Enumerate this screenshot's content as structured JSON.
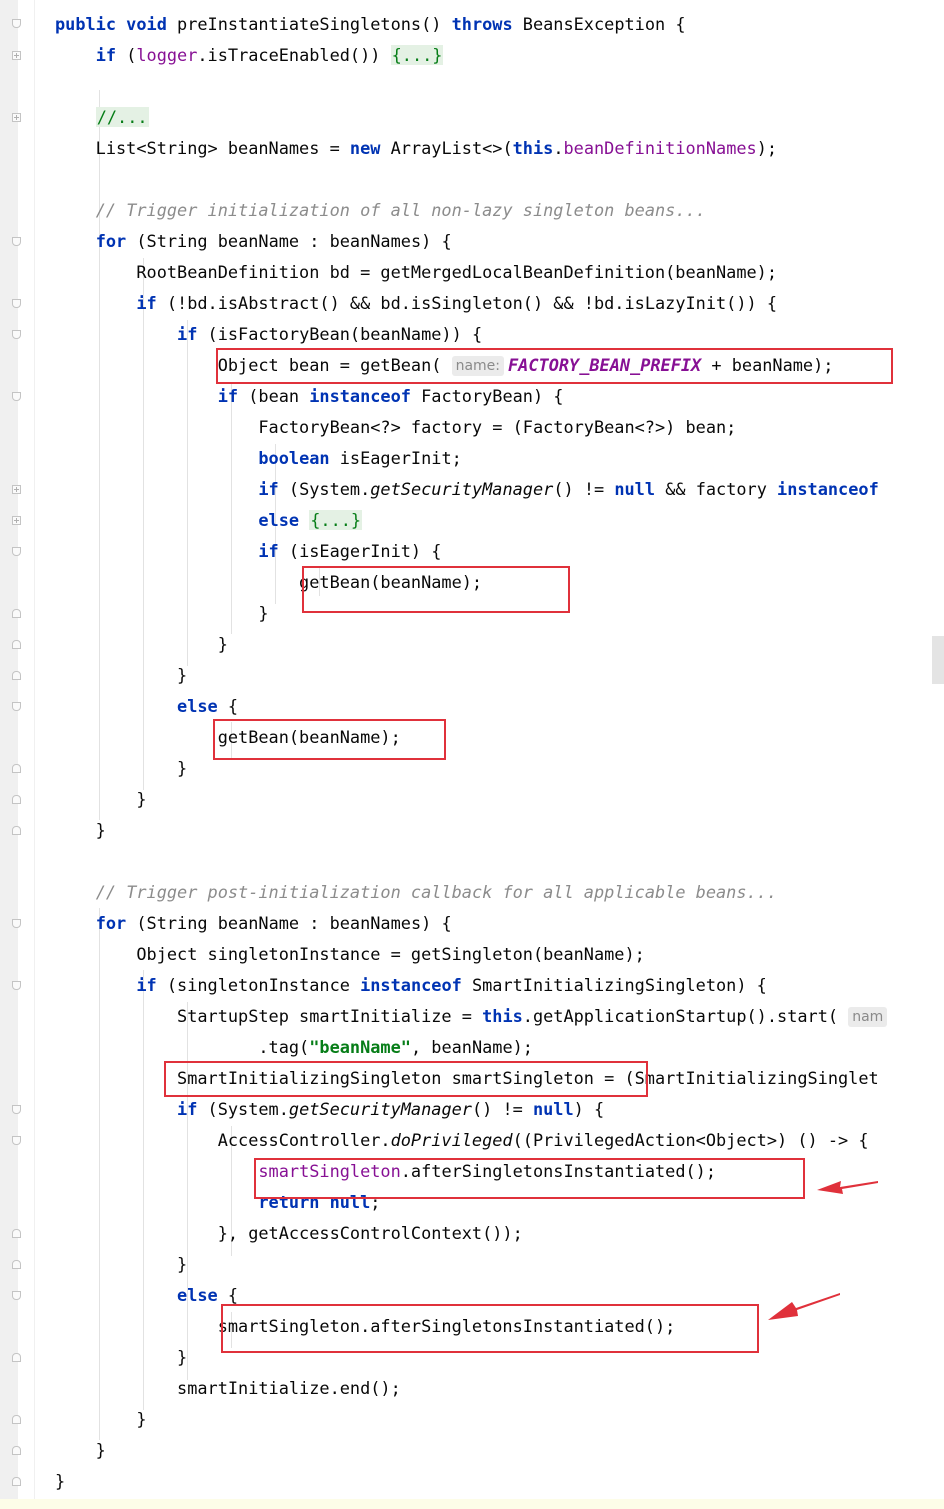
{
  "editor": {
    "lines": [
      [
        {
          "t": "public void ",
          "c": "kw"
        },
        {
          "t": "preInstantiateSingletons() "
        },
        {
          "t": "throws ",
          "c": "kw"
        },
        {
          "t": "BeansException {"
        }
      ],
      [
        {
          "t": "    "
        },
        {
          "t": "if ",
          "c": "kw"
        },
        {
          "t": "("
        },
        {
          "t": "logger",
          "c": "fld"
        },
        {
          "t": ".isTraceEnabled()) "
        },
        {
          "t": "{...}",
          "c": "fold-ph"
        }
      ],
      [],
      [
        {
          "t": "    "
        },
        {
          "t": "//...",
          "c": "fold-ph"
        }
      ],
      [
        {
          "t": "    List<String> beanNames = "
        },
        {
          "t": "new ",
          "c": "kw"
        },
        {
          "t": "ArrayList<>("
        },
        {
          "t": "this",
          "c": "kw"
        },
        {
          "t": "."
        },
        {
          "t": "beanDefinitionNames",
          "c": "fld"
        },
        {
          "t": ");"
        }
      ],
      [],
      [
        {
          "t": "    "
        },
        {
          "t": "// Trigger initialization of all non-lazy singleton beans...",
          "c": "cm"
        }
      ],
      [
        {
          "t": "    "
        },
        {
          "t": "for ",
          "c": "kw"
        },
        {
          "t": "(String beanName : beanNames) {"
        }
      ],
      [
        {
          "t": "        RootBeanDefinition bd = getMergedLocalBeanDefinition(beanName);"
        }
      ],
      [
        {
          "t": "        "
        },
        {
          "t": "if ",
          "c": "kw"
        },
        {
          "t": "(!bd.isAbstract() && bd.isSingleton() && !bd.isLazyInit()) {"
        }
      ],
      [
        {
          "t": "            "
        },
        {
          "t": "if ",
          "c": "kw"
        },
        {
          "t": "(isFactoryBean(beanName)) {"
        }
      ],
      [
        {
          "t": "                Object bean = getBean( "
        },
        {
          "t": "name:",
          "c": "hint"
        },
        {
          "t": "FACTORY_BEAN_PREFIX",
          "c": "fldi"
        },
        {
          "t": " + beanName);"
        }
      ],
      [
        {
          "t": "                "
        },
        {
          "t": "if ",
          "c": "kw"
        },
        {
          "t": "(bean "
        },
        {
          "t": "instanceof ",
          "c": "kw"
        },
        {
          "t": "FactoryBean) {"
        }
      ],
      [
        {
          "t": "                    FactoryBean<?> factory = (FactoryBean<?>) bean;"
        }
      ],
      [
        {
          "t": "                    "
        },
        {
          "t": "boolean ",
          "c": "kw"
        },
        {
          "t": "isEagerInit;"
        }
      ],
      [
        {
          "t": "                    "
        },
        {
          "t": "if ",
          "c": "kw"
        },
        {
          "t": "(System."
        },
        {
          "t": "getSecurityManager",
          "c": "it"
        },
        {
          "t": "() != "
        },
        {
          "t": "null ",
          "c": "kw"
        },
        {
          "t": "&& factory "
        },
        {
          "t": "instanceof",
          "c": "kw"
        }
      ],
      [
        {
          "t": "                    "
        },
        {
          "t": "else ",
          "c": "kw"
        },
        {
          "t": "{...}",
          "c": "fold-ph"
        }
      ],
      [
        {
          "t": "                    "
        },
        {
          "t": "if ",
          "c": "kw"
        },
        {
          "t": "(isEagerInit) {"
        }
      ],
      [
        {
          "t": "                        getBean(beanName);"
        }
      ],
      [
        {
          "t": "                    }"
        }
      ],
      [
        {
          "t": "                }"
        }
      ],
      [
        {
          "t": "            }"
        }
      ],
      [
        {
          "t": "            "
        },
        {
          "t": "else ",
          "c": "kw"
        },
        {
          "t": "{"
        }
      ],
      [
        {
          "t": "                getBean(beanName);"
        }
      ],
      [
        {
          "t": "            }"
        }
      ],
      [
        {
          "t": "        }"
        }
      ],
      [
        {
          "t": "    }"
        }
      ],
      [],
      [
        {
          "t": "    "
        },
        {
          "t": "// Trigger post-initialization callback for all applicable beans...",
          "c": "cm"
        }
      ],
      [
        {
          "t": "    "
        },
        {
          "t": "for ",
          "c": "kw"
        },
        {
          "t": "(String beanName : beanNames) {"
        }
      ],
      [
        {
          "t": "        Object singletonInstance = getSingleton(beanName);"
        }
      ],
      [
        {
          "t": "        "
        },
        {
          "t": "if ",
          "c": "kw"
        },
        {
          "t": "(singletonInstance "
        },
        {
          "t": "instanceof ",
          "c": "kw"
        },
        {
          "t": "SmartInitializingSingleton) {"
        }
      ],
      [
        {
          "t": "            StartupStep smartInitialize = "
        },
        {
          "t": "this",
          "c": "kw"
        },
        {
          "t": ".getApplicationStartup().start( "
        },
        {
          "t": "nam",
          "c": "hint"
        }
      ],
      [
        {
          "t": "                    .tag("
        },
        {
          "t": "\"beanName\"",
          "c": "str"
        },
        {
          "t": ", beanName);"
        }
      ],
      [
        {
          "t": "            SmartInitializingSingleton smartSingleton = (SmartInitializingSinglet"
        }
      ],
      [
        {
          "t": "            "
        },
        {
          "t": "if ",
          "c": "kw"
        },
        {
          "t": "(System."
        },
        {
          "t": "getSecurityManager",
          "c": "it"
        },
        {
          "t": "() != "
        },
        {
          "t": "null",
          "c": "kw"
        },
        {
          "t": ") {"
        }
      ],
      [
        {
          "t": "                AccessController."
        },
        {
          "t": "doPrivileged",
          "c": "it"
        },
        {
          "t": "((PrivilegedAction<Object>) () -> {"
        }
      ],
      [
        {
          "t": "                    "
        },
        {
          "t": "smartSingleton",
          "c": "fld"
        },
        {
          "t": ".afterSingletonsInstantiated();"
        }
      ],
      [
        {
          "t": "                    "
        },
        {
          "t": "return null",
          "c": "kw"
        },
        {
          "t": ";"
        }
      ],
      [
        {
          "t": "                }, getAccessControlContext());"
        }
      ],
      [
        {
          "t": "            }"
        }
      ],
      [
        {
          "t": "            "
        },
        {
          "t": "else ",
          "c": "kw"
        },
        {
          "t": "{"
        }
      ],
      [
        {
          "t": "                smartSingleton.afterSingletonsInstantiated();"
        }
      ],
      [
        {
          "t": "            }"
        }
      ],
      [
        {
          "t": "            smartInitialize.end();"
        }
      ],
      [
        {
          "t": "        }"
        }
      ],
      [
        {
          "t": "    }"
        }
      ],
      [
        {
          "t": "}"
        }
      ]
    ]
  }
}
